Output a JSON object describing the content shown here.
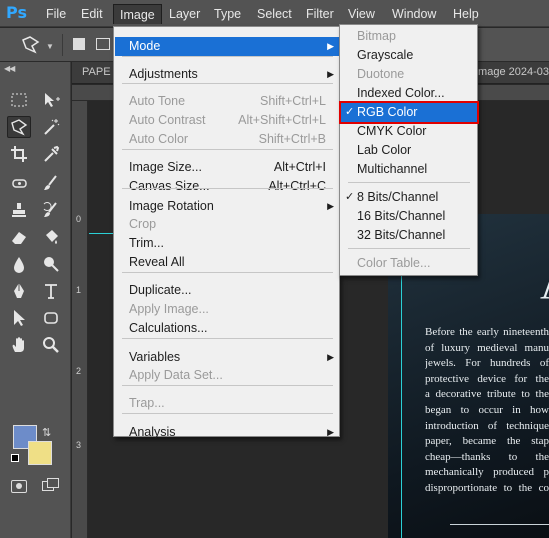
{
  "app": {
    "logo": "Ps"
  },
  "menubar": {
    "items": [
      "File",
      "Edit",
      "Image",
      "Layer",
      "Type",
      "Select",
      "Filter",
      "View",
      "Window",
      "Help"
    ],
    "active": "Image"
  },
  "document": {
    "tab_left": "PAPE",
    "tab_right": "image 2024-03",
    "ruler_top_marks": [],
    "ruler_left_marks": [
      "0",
      "1",
      "2",
      "3"
    ],
    "big_glyph": "A",
    "body_lines": [
      "Before the early nineteenth",
      "of luxury medieval manu",
      "jewels. For hundreds of",
      "protective device for the",
      "a decorative tribute to the",
      "began to occur in how",
      "introduction of technique",
      "paper, became the stap",
      "cheap—thanks to the",
      "mechanically produced p",
      "disproportionate to the co"
    ]
  },
  "colors": {
    "foreground": "#6d8cc9",
    "background": "#efdf86",
    "highlight": "#1a70d5",
    "selection_outline": "#e00000",
    "guide": "#2bd0d6"
  },
  "image_menu": {
    "items": [
      {
        "label": "Mode",
        "submenu": true,
        "highlighted": true
      },
      {
        "label": "Adjustments",
        "submenu": true
      },
      {
        "label": "Auto Tone",
        "shortcut": "Shift+Ctrl+L",
        "disabled": true
      },
      {
        "label": "Auto Contrast",
        "shortcut": "Alt+Shift+Ctrl+L",
        "disabled": true
      },
      {
        "label": "Auto Color",
        "shortcut": "Shift+Ctrl+B",
        "disabled": true
      },
      {
        "label": "Image Size...",
        "shortcut": "Alt+Ctrl+I"
      },
      {
        "label": "Canvas Size...",
        "shortcut": "Alt+Ctrl+C"
      },
      {
        "label": "Image Rotation",
        "submenu": true
      },
      {
        "label": "Crop",
        "disabled": true
      },
      {
        "label": "Trim..."
      },
      {
        "label": "Reveal All"
      },
      {
        "label": "Duplicate..."
      },
      {
        "label": "Apply Image...",
        "disabled": true
      },
      {
        "label": "Calculations..."
      },
      {
        "label": "Variables",
        "submenu": true
      },
      {
        "label": "Apply Data Set...",
        "disabled": true
      },
      {
        "label": "Trap...",
        "disabled": true
      },
      {
        "label": "Analysis",
        "submenu": true
      }
    ]
  },
  "mode_submenu": {
    "items": [
      {
        "label": "Bitmap",
        "disabled": true
      },
      {
        "label": "Grayscale"
      },
      {
        "label": "Duotone",
        "disabled": true
      },
      {
        "label": "Indexed Color..."
      },
      {
        "label": "RGB Color",
        "checked": true,
        "highlighted": true
      },
      {
        "label": "CMYK Color"
      },
      {
        "label": "Lab Color"
      },
      {
        "label": "Multichannel"
      },
      {
        "label": "8 Bits/Channel",
        "checked": true
      },
      {
        "label": "16 Bits/Channel"
      },
      {
        "label": "32 Bits/Channel"
      },
      {
        "label": "Color Table...",
        "disabled": true
      }
    ],
    "check_glyph": "✓"
  },
  "toolbar": {
    "tools": [
      "rectangular-marquee",
      "move",
      "polygonal-lasso",
      "magic-wand",
      "crop",
      "eyedropper",
      "spot-healing",
      "brush",
      "clone-stamp",
      "history-brush",
      "eraser",
      "paint-bucket",
      "blur",
      "dodge",
      "pen",
      "type",
      "path-selection",
      "rectangle",
      "hand",
      "zoom"
    ],
    "selected": "polygonal-lasso"
  }
}
